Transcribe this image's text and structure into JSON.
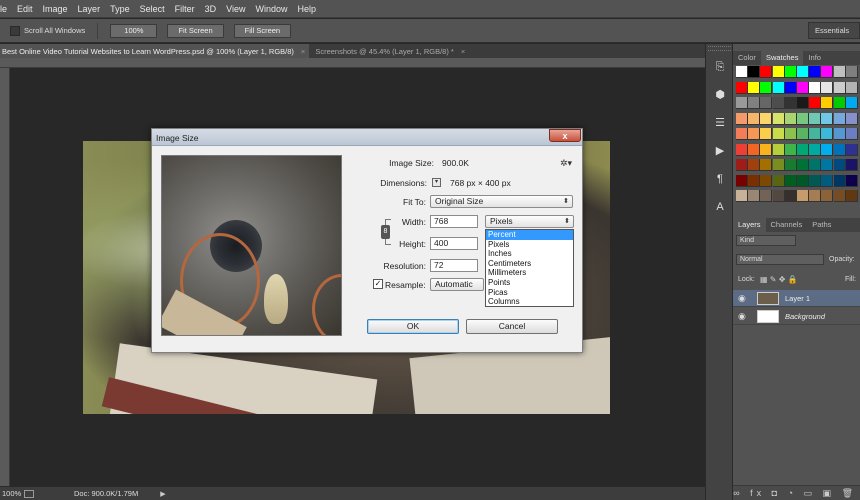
{
  "menu": [
    "le",
    "Edit",
    "Image",
    "Layer",
    "Type",
    "Select",
    "Filter",
    "3D",
    "View",
    "Window",
    "Help"
  ],
  "options": {
    "scroll_all": "Scroll All Windows",
    "btn_100": "100%",
    "btn_fit": "Fit Screen",
    "btn_fill": "Fill Screen",
    "workspace": "Essentials"
  },
  "tabs": [
    {
      "label": "Best Online Video Tutorial Websites to Learn WordPress.psd @ 100% (Layer 1, RGB/8)",
      "close": "×"
    },
    {
      "label": "Screenshots @ 45.4% (Layer 1, RGB/8) *",
      "close": "×"
    }
  ],
  "status": {
    "zoom": "100%",
    "doc": "Doc: 900.0K/1.79M",
    "arrow": "▶"
  },
  "dialog": {
    "title": "Image Size",
    "close": "x",
    "image_size_label": "Image Size:",
    "image_size_value": "900.0K",
    "gear": "✲▾",
    "dimensions_label": "Dimensions:",
    "dimensions_toggle": "▾",
    "dimensions_value": "768 px  ×  400 px",
    "fit_label": "Fit To:",
    "fit_value": "Original Size",
    "width_label": "Width:",
    "width_value": "768",
    "width_unit": "Pixels",
    "height_label": "Height:",
    "height_value": "400",
    "chain": "8",
    "resolution_label": "Resolution:",
    "resolution_value": "72",
    "resample_label": "Resample:",
    "resample_check": "✓",
    "resample_value": "Automatic",
    "ok": "OK",
    "cancel": "Cancel",
    "units": [
      "Percent",
      "Pixels",
      "Inches",
      "Centimeters",
      "Millimeters",
      "Points",
      "Picas",
      "Columns"
    ],
    "selected_unit_index": 0
  },
  "panel": {
    "tabs_top": [
      "Color",
      "Swatches",
      "Info"
    ],
    "active_top": "Swatches",
    "tabs_layers": [
      "Layers",
      "Channels",
      "Paths"
    ],
    "active_layers": "Layers",
    "kind": "Kind",
    "blend": "Normal",
    "opacity": "Opacity:",
    "lock": "Lock:",
    "fill": "Fill:",
    "layers": [
      {
        "name": "Layer 1",
        "selected": true
      },
      {
        "name": "Background",
        "selected": false
      }
    ],
    "footer_icons": "∞ fx ◘ ◔ ▭ ▣ 🗑"
  },
  "swatch_colors": [
    [
      "#ffffff",
      "#000000",
      "#ff0000",
      "#ffff00",
      "#00ff00",
      "#00ffff",
      "#0000ff",
      "#ff00ff",
      "#bfbfbf",
      "#7f7f7f"
    ],
    [
      "#ff0000",
      "#ffff00",
      "#00ff00",
      "#00ffff",
      "#0000ff",
      "#ff00ff",
      "#ffffff",
      "#e6e6e6",
      "#cccccc",
      "#b3b3b3"
    ],
    [
      "#999999",
      "#808080",
      "#666666",
      "#4d4d4d",
      "#333333",
      "#1a1a1a",
      "#ff0000",
      "#ffcc00",
      "#00cc00",
      "#00aaee"
    ],
    [
      "#f59b6b",
      "#f7b56a",
      "#fbd46b",
      "#d8e36b",
      "#a9d470",
      "#78c77e",
      "#6fc7b4",
      "#6fc8e4",
      "#76a8dc",
      "#8691cc"
    ],
    [
      "#f37d58",
      "#f69855",
      "#facd4a",
      "#c9dc4a",
      "#8cc14f",
      "#5ab462",
      "#45b59e",
      "#3cb8d8",
      "#5597d2",
      "#6c7ec1"
    ],
    [
      "#ee3f37",
      "#f26522",
      "#f8b21c",
      "#b4cf3a",
      "#3db54a",
      "#00a874",
      "#00aaa0",
      "#00aeef",
      "#0072bc",
      "#2e3192"
    ],
    [
      "#9e1c1a",
      "#a0410d",
      "#a37000",
      "#7a8d21",
      "#197b30",
      "#007236",
      "#00746b",
      "#0076a3",
      "#004a80",
      "#1b1464"
    ],
    [
      "#790000",
      "#7b2e00",
      "#7d4900",
      "#586512",
      "#005e20",
      "#005826",
      "#005952",
      "#005b7f",
      "#003663",
      "#0d004c"
    ],
    [
      "#c7b299",
      "#998675",
      "#736357",
      "#534741",
      "#362f2d",
      "#c69c6d",
      "#a67c52",
      "#8c6239",
      "#754c24",
      "#603913"
    ]
  ]
}
